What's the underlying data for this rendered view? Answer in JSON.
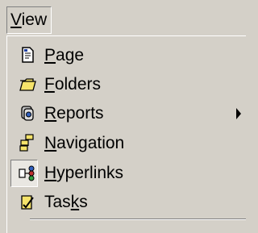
{
  "menubar": {
    "view": {
      "accel": "V",
      "rest": "iew"
    }
  },
  "menu": {
    "items": [
      {
        "pre": "",
        "accel": "P",
        "post": "age",
        "icon": "page-icon",
        "submenu": false,
        "checked": false
      },
      {
        "pre": "",
        "accel": "F",
        "post": "olders",
        "icon": "folder-icon",
        "submenu": false,
        "checked": false
      },
      {
        "pre": "",
        "accel": "R",
        "post": "eports",
        "icon": "reports-icon",
        "submenu": true,
        "checked": false
      },
      {
        "pre": "",
        "accel": "N",
        "post": "avigation",
        "icon": "navigation-icon",
        "submenu": false,
        "checked": false
      },
      {
        "pre": "",
        "accel": "H",
        "post": "yperlinks",
        "icon": "hyperlinks-icon",
        "submenu": false,
        "checked": true
      },
      {
        "pre": "Tas",
        "accel": "k",
        "post": "s",
        "icon": "tasks-icon",
        "submenu": false,
        "checked": false
      }
    ]
  }
}
